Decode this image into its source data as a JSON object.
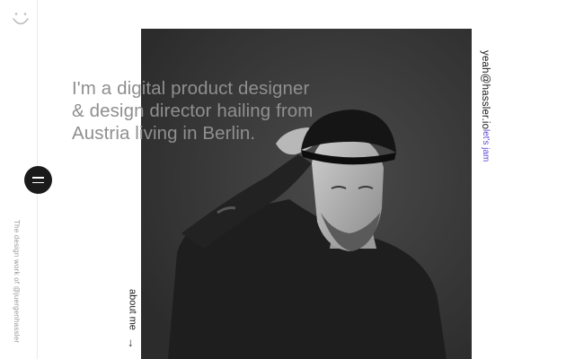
{
  "sidebar": {
    "logo_icon": "smiley-icon",
    "menu_icon": "hamburger-menu-icon",
    "credit_text": "The design work of @juergenhassler"
  },
  "hero": {
    "headline_lines": [
      "I'm a digital product designer",
      "& design director hailing from",
      "Austria living in Berlin."
    ],
    "about_label": "about me",
    "about_arrow": "→"
  },
  "contact": {
    "tagline": "let's jam",
    "email": "yeah@hassler.io"
  },
  "colors": {
    "accent": "#5b4bd6",
    "headline_text": "#8f8f8f",
    "dark": "#1b1b1b",
    "photo_bg": "#343434"
  }
}
